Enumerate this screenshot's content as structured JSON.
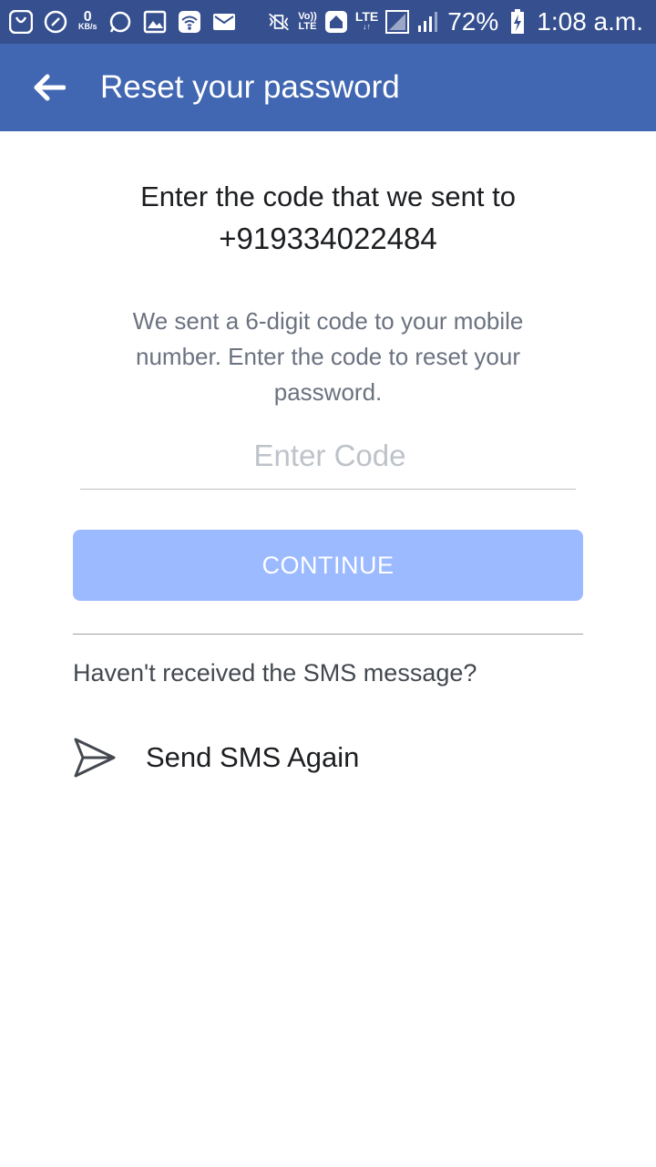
{
  "status_bar": {
    "speed_value": "0",
    "speed_unit": "KB/s",
    "volte_top": "Vo))",
    "volte_bottom": "LTE",
    "lte_label": "LTE",
    "battery_percent": "72%",
    "time": "1:08 a.m."
  },
  "app_bar": {
    "title": "Reset your password"
  },
  "content": {
    "heading": "Enter the code that we sent to",
    "phone_number": "+919334022484",
    "description": "We sent a 6-digit code to your mobile number. Enter the code to reset your password.",
    "code_input": {
      "placeholder": "Enter Code",
      "value": ""
    },
    "continue_label": "CONTINUE",
    "sms_question": "Haven't received the SMS message?",
    "send_again_label": "Send SMS Again"
  },
  "colors": {
    "status_bar": "#354f8f",
    "app_bar": "#4267b2",
    "button_disabled": "#9cbaff"
  }
}
